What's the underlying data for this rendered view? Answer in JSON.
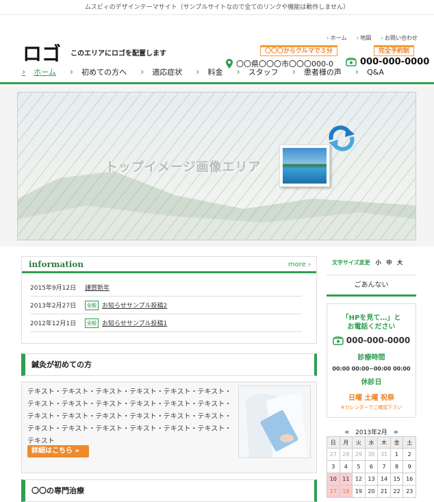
{
  "topbar": "ムスビィのデザインテーマサイト（サンプルサイトなので全てのリンクや機能は動作しません）",
  "logo": "ロゴ",
  "tagline": "このエリアにロゴを配置します",
  "util": [
    "ホーム",
    "地図",
    "お問い合わせ"
  ],
  "badges": {
    "car": "〇〇〇からクルマで３分",
    "reserve": "完全予約制"
  },
  "address": "〇〇県〇〇〇市〇〇〇000-0",
  "phone": "000-000-0000",
  "nav": [
    "ホーム",
    "初めての方へ",
    "適応症状",
    "料金",
    "スタッフ",
    "患者様の声",
    "Q&A"
  ],
  "hero_text": "トップイメージ画像エリア",
  "info": {
    "title": "information",
    "more": "more ›",
    "rows": [
      {
        "date": "2015年9月12日",
        "tag": "",
        "text": "謹賀新年"
      },
      {
        "date": "2013年2月27日",
        "tag": "全般",
        "text": "お知らせサンプル投稿2"
      },
      {
        "date": "2012年12月1日",
        "tag": "全般",
        "text": "お知らせサンプル投稿1"
      }
    ]
  },
  "sec1": "鍼灸が初めての方",
  "body_text": "テキスト・テキスト・テキスト・テキスト・テキスト・テキスト・テキスト・テキスト・テキスト・テキスト・テキスト・テキスト・テキスト・テキスト・テキスト・テキスト・テキスト・テキスト・テキスト・テキスト・テキスト・テキスト・テキスト・テキスト・テキスト",
  "detail_btn": "詳細はこちら »",
  "sec2": "〇〇の専門治療",
  "fontsize": {
    "label": "文字サイズ変更",
    "s": "小",
    "m": "中",
    "l": "大"
  },
  "annai": "ごあんない",
  "sidebox": {
    "l1": "「HPを見て…」と",
    "l2": "お電話ください",
    "phone": "000-000-0000",
    "hours_title": "診療時間",
    "hours": "00:00 00:00~00:00 00:00",
    "holiday_title": "休診日",
    "holidays": "日曜 土曜 祝祭",
    "cal_link": "※カレンダーでご確認下さい"
  },
  "calendar": {
    "title": "2013年2月",
    "prev": "«",
    "next": "»",
    "days": [
      "日",
      "月",
      "火",
      "水",
      "木",
      "金",
      "土"
    ],
    "weeks": [
      [
        "27",
        "28",
        "29",
        "30",
        "31",
        "1",
        "2"
      ],
      [
        "3",
        "4",
        "5",
        "6",
        "7",
        "8",
        "9"
      ],
      [
        "10",
        "11",
        "12",
        "13",
        "14",
        "15",
        "16"
      ],
      [
        "17",
        "18",
        "19",
        "20",
        "21",
        "22",
        "23"
      ]
    ]
  }
}
